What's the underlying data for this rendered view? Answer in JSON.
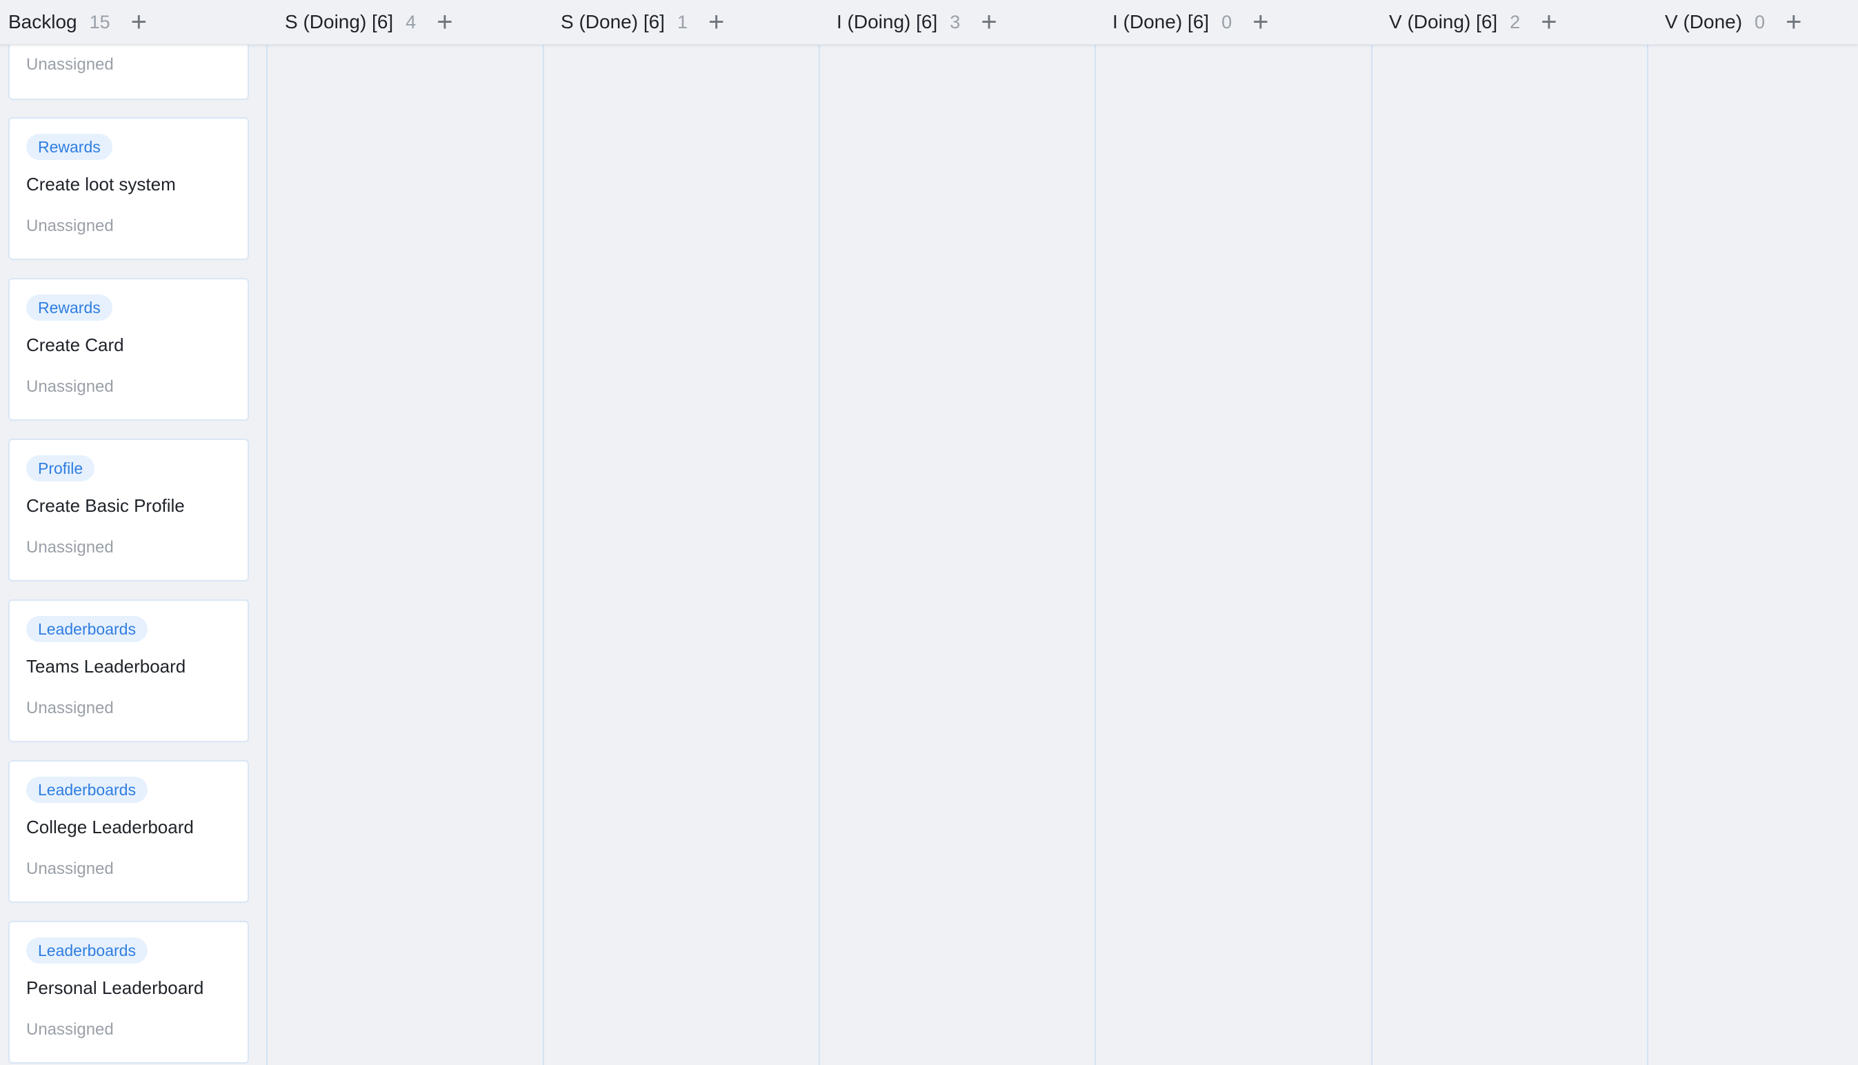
{
  "board": {
    "columns": [
      {
        "title": "Backlog",
        "count": "15",
        "add_label": "+"
      },
      {
        "title": "S (Doing) [6]",
        "count": "4",
        "add_label": "+"
      },
      {
        "title": "S (Done) [6]",
        "count": "1",
        "add_label": "+"
      },
      {
        "title": "I (Doing) [6]",
        "count": "3",
        "add_label": "+"
      },
      {
        "title": "I (Done) [6]",
        "count": "0",
        "add_label": "+"
      },
      {
        "title": "V (Doing) [6]",
        "count": "2",
        "add_label": "+"
      },
      {
        "title": "V (Done)",
        "count": "0",
        "add_label": "+"
      }
    ],
    "backlog_cards": [
      {
        "tag": "",
        "title": "",
        "assignee": "Unassigned"
      },
      {
        "tag": "Rewards",
        "title": "Create loot system",
        "assignee": "Unassigned"
      },
      {
        "tag": "Rewards",
        "title": "Create Card",
        "assignee": "Unassigned"
      },
      {
        "tag": "Profile",
        "title": "Create Basic Profile",
        "assignee": "Unassigned"
      },
      {
        "tag": "Leaderboards",
        "title": "Teams Leaderboard",
        "assignee": "Unassigned"
      },
      {
        "tag": "Leaderboards",
        "title": "College Leaderboard",
        "assignee": "Unassigned"
      },
      {
        "tag": "Leaderboards",
        "title": "Personal Leaderboard",
        "assignee": "Unassigned"
      }
    ]
  },
  "colors": {
    "background": "#eff1f5",
    "tag_background": "#e6f1fd",
    "tag_text": "#2f7de1",
    "column_divider": "#d3e3f4"
  }
}
